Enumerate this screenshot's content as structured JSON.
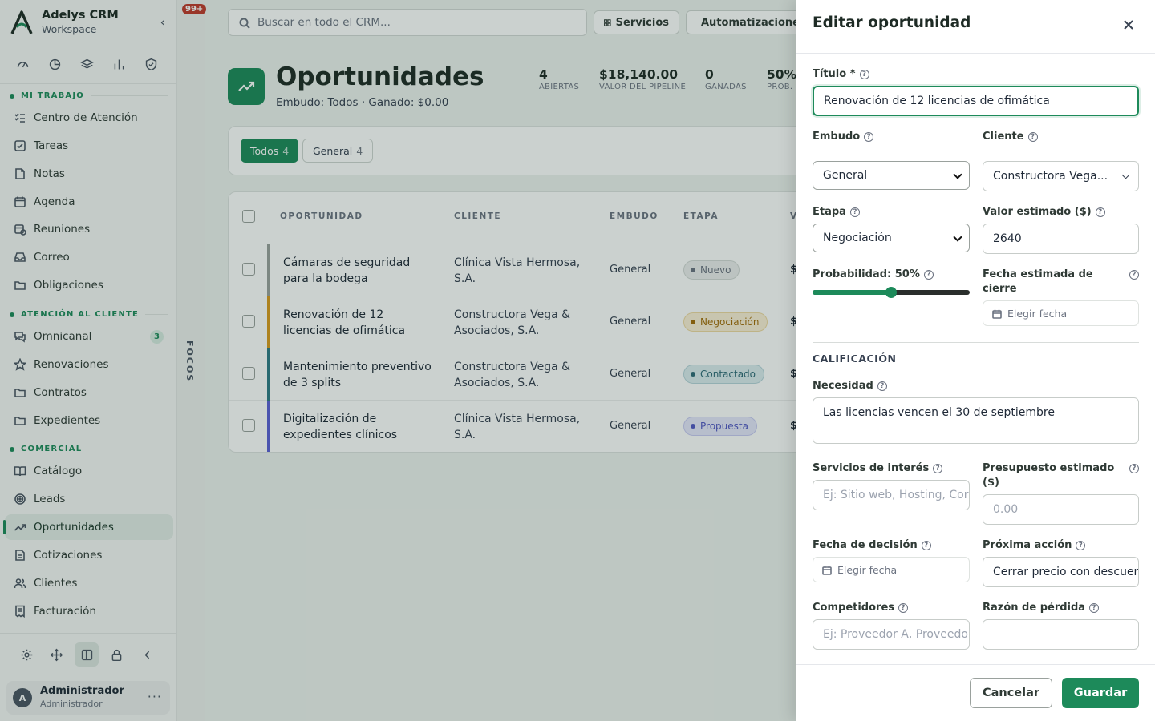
{
  "app": {
    "name": "Adelys CRM",
    "workspace": "Workspace",
    "notifications": "99+"
  },
  "sidebar": {
    "sections": [
      {
        "label": "MI TRABAJO"
      },
      {
        "label": "ATENCIÓN AL CLIENTE"
      },
      {
        "label": "COMERCIAL"
      }
    ],
    "items": [
      {
        "label": "Centro de Atención",
        "icon": "list-check-icon"
      },
      {
        "label": "Tareas",
        "icon": "checkbox-icon"
      },
      {
        "label": "Notas",
        "icon": "note-icon"
      },
      {
        "label": "Agenda",
        "icon": "calendar-icon"
      },
      {
        "label": "Reuniones",
        "icon": "calendar-clock-icon"
      },
      {
        "label": "Correo",
        "icon": "inbox-icon"
      },
      {
        "label": "Obligaciones",
        "icon": "folder-icon"
      },
      {
        "label": "Omnicanal",
        "icon": "chat-icon",
        "count": "3"
      },
      {
        "label": "Renovaciones",
        "icon": "star-icon"
      },
      {
        "label": "Contratos",
        "icon": "folder-icon"
      },
      {
        "label": "Expedientes",
        "icon": "folder-icon"
      },
      {
        "label": "Catálogo",
        "icon": "book-icon"
      },
      {
        "label": "Leads",
        "icon": "target-icon"
      },
      {
        "label": "Oportunidades",
        "icon": "trending-up-icon",
        "active": true
      },
      {
        "label": "Cotizaciones",
        "icon": "document-icon"
      },
      {
        "label": "Clientes",
        "icon": "users-icon"
      },
      {
        "label": "Facturación",
        "icon": "receipt-icon"
      }
    ],
    "user": {
      "initial": "A",
      "name": "Administrador",
      "role": "Administrador"
    },
    "focos_label": "FOCOS"
  },
  "topbar": {
    "search_placeholder": "Buscar en todo el CRM...",
    "buttons": [
      "Servicios",
      "Automatizaciones"
    ]
  },
  "page": {
    "title": "Oportunidades",
    "subtitle": "Embudo: Todos · Ganado: $0.00",
    "stats": [
      {
        "value": "4",
        "label": "ABIERTAS"
      },
      {
        "value": "$18,140.00",
        "label": "VALOR DEL PIPELINE"
      },
      {
        "value": "0",
        "label": "GANADAS"
      },
      {
        "value": "50%",
        "label": "PROB."
      }
    ],
    "filters": [
      {
        "label": "Todos",
        "count": "4",
        "active": true
      },
      {
        "label": "General",
        "count": "4",
        "active": false
      }
    ],
    "table": {
      "columns": [
        "OPORTUNIDAD",
        "CLIENTE",
        "EMBUDO",
        "ETAPA",
        "V"
      ],
      "rows": [
        {
          "opportunity": "Cámaras de seguridad para la bodega",
          "client": "Clínica Vista Hermosa, S.A.",
          "funnel": "General",
          "stage": "Nuevo",
          "value": "$",
          "bar_color": "#9aa19d",
          "stage_bg": "#eceeed",
          "stage_fg": "#6b7280",
          "stage_border": "#d3d8d5"
        },
        {
          "opportunity": "Renovación de 12 licencias de ofimática",
          "client": "Constructora Vega & Asociados, S.A.",
          "funnel": "General",
          "stage": "Negociación",
          "value": "$",
          "bar_color": "#d99a1e",
          "stage_bg": "#fbf0d6",
          "stage_fg": "#a36c08",
          "stage_border": "#efd9a2"
        },
        {
          "opportunity": "Mantenimiento preventivo de 3 splits",
          "client": "Constructora Vega & Asociados, S.A.",
          "funnel": "General",
          "stage": "Contactado",
          "value": "$",
          "bar_color": "#2f7a86",
          "stage_bg": "#dcecef",
          "stage_fg": "#2f6b78",
          "stage_border": "#b7d4da"
        },
        {
          "opportunity": "Digitalización de expedientes clínicos",
          "client": "Clínica Vista Hermosa, S.A.",
          "funnel": "General",
          "stage": "Propuesta",
          "value": "$",
          "bar_color": "#5b5fd6",
          "stage_bg": "#e6e7fb",
          "stage_fg": "#5156c4",
          "stage_border": "#c8caf2"
        }
      ]
    }
  },
  "drawer": {
    "title": "Editar oportunidad",
    "fields": {
      "titulo": {
        "label": "Título *",
        "value": "Renovación de 12 licencias de ofimática"
      },
      "embudo": {
        "label": "Embudo",
        "value": "General"
      },
      "cliente": {
        "label": "Cliente",
        "value": "Constructora Vega..."
      },
      "etapa": {
        "label": "Etapa",
        "value": "Negociación"
      },
      "valor": {
        "label": "Valor estimado ($)",
        "value": "2640"
      },
      "probabilidad": {
        "label": "Probabilidad: 50%",
        "percent": 50
      },
      "fecha_cierre": {
        "label": "Fecha estimada de cierre",
        "placeholder": "Elegir fecha"
      },
      "seccion": "CALIFICACIÓN",
      "necesidad": {
        "label": "Necesidad",
        "value": "Las licencias vencen el 30 de septiembre"
      },
      "servicios": {
        "label": "Servicios de interés",
        "placeholder": "Ej: Sitio web, Hosting, Correo"
      },
      "presupuesto": {
        "label": "Presupuesto estimado ($)",
        "placeholder": "0.00"
      },
      "fecha_decision": {
        "label": "Fecha de decisión",
        "placeholder": "Elegir fecha"
      },
      "proxima_accion": {
        "label": "Próxima acción",
        "value": "Cerrar precio con descuento"
      },
      "competidores": {
        "label": "Competidores",
        "placeholder": "Ej: Proveedor A, Proveedor B"
      },
      "razon_perdida": {
        "label": "Razón de pérdida",
        "value": ""
      }
    },
    "cancel_label": "Cancelar",
    "save_label": "Guardar"
  },
  "colors": {
    "accent": "#1d8a5a"
  }
}
